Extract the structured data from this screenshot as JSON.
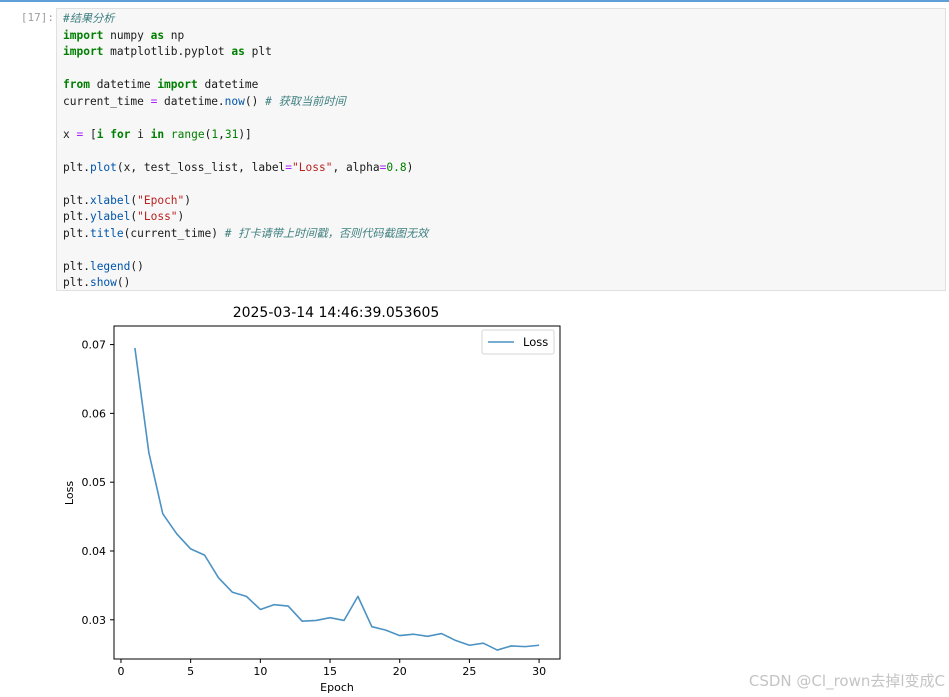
{
  "cell": {
    "prompt": "[17]:",
    "code_lines": [
      [
        {
          "t": "#结果分析",
          "c": "cm"
        }
      ],
      [
        {
          "t": "import",
          "c": "kw"
        },
        {
          "t": " numpy "
        },
        {
          "t": "as",
          "c": "kw"
        },
        {
          "t": " np"
        }
      ],
      [
        {
          "t": "import",
          "c": "kw"
        },
        {
          "t": " matplotlib.pyplot "
        },
        {
          "t": "as",
          "c": "kw"
        },
        {
          "t": " plt"
        }
      ],
      [],
      [
        {
          "t": "from",
          "c": "kw"
        },
        {
          "t": " datetime "
        },
        {
          "t": "import",
          "c": "kw"
        },
        {
          "t": " datetime"
        }
      ],
      [
        {
          "t": "current_time "
        },
        {
          "t": "=",
          "c": "op"
        },
        {
          "t": " datetime."
        },
        {
          "t": "now",
          "c": "fn"
        },
        {
          "t": "() "
        },
        {
          "t": "# 获取当前时间",
          "c": "cm"
        }
      ],
      [],
      [
        {
          "t": "x "
        },
        {
          "t": "=",
          "c": "op"
        },
        {
          "t": " ["
        },
        {
          "t": "i",
          "c": "kw"
        },
        {
          "t": " "
        },
        {
          "t": "for",
          "c": "kw"
        },
        {
          "t": " i "
        },
        {
          "t": "in",
          "c": "kw"
        },
        {
          "t": " "
        },
        {
          "t": "range",
          "c": "num"
        },
        {
          "t": "("
        },
        {
          "t": "1",
          "c": "num"
        },
        {
          "t": ","
        },
        {
          "t": "31",
          "c": "num"
        },
        {
          "t": ")]"
        }
      ],
      [],
      [
        {
          "t": "plt."
        },
        {
          "t": "plot",
          "c": "fn"
        },
        {
          "t": "(x, test_loss_list, label"
        },
        {
          "t": "=",
          "c": "op"
        },
        {
          "t": "\"Loss\"",
          "c": "str"
        },
        {
          "t": ", alpha"
        },
        {
          "t": "=",
          "c": "op"
        },
        {
          "t": "0.8",
          "c": "num"
        },
        {
          "t": ")"
        }
      ],
      [],
      [
        {
          "t": "plt."
        },
        {
          "t": "xlabel",
          "c": "fn"
        },
        {
          "t": "("
        },
        {
          "t": "\"Epoch\"",
          "c": "str"
        },
        {
          "t": ")"
        }
      ],
      [
        {
          "t": "plt."
        },
        {
          "t": "ylabel",
          "c": "fn"
        },
        {
          "t": "("
        },
        {
          "t": "\"Loss\"",
          "c": "str"
        },
        {
          "t": ")"
        }
      ],
      [
        {
          "t": "plt."
        },
        {
          "t": "title",
          "c": "fn"
        },
        {
          "t": "(current_time) "
        },
        {
          "t": "# 打卡请带上时间戳，否则代码截图无效",
          "c": "cm"
        }
      ],
      [],
      [
        {
          "t": "plt."
        },
        {
          "t": "legend",
          "c": "fn"
        },
        {
          "t": "()"
        }
      ],
      [
        {
          "t": "plt."
        },
        {
          "t": "show",
          "c": "fn"
        },
        {
          "t": "()"
        }
      ]
    ]
  },
  "chart_data": {
    "type": "line",
    "title": "2025-03-14 14:46:39.053605",
    "xlabel": "Epoch",
    "ylabel": "Loss",
    "xlim": [
      -0.5,
      31.5
    ],
    "ylim": [
      0.0243,
      0.0727
    ],
    "xticks": [
      0,
      5,
      10,
      15,
      20,
      25,
      30
    ],
    "yticks": [
      0.03,
      0.04,
      0.05,
      0.06,
      0.07
    ],
    "ytick_labels": [
      "0.03",
      "0.04",
      "0.05",
      "0.06",
      "0.07"
    ],
    "legend_position": "top-right",
    "grid": false,
    "color": "#1f77b4",
    "alpha": 0.8,
    "series": [
      {
        "name": "Loss",
        "x": [
          1,
          2,
          3,
          4,
          5,
          6,
          7,
          8,
          9,
          10,
          11,
          12,
          13,
          14,
          15,
          16,
          17,
          18,
          19,
          20,
          21,
          22,
          23,
          24,
          25,
          26,
          27,
          28,
          29,
          30
        ],
        "y": [
          0.0695,
          0.0543,
          0.0454,
          0.0425,
          0.0403,
          0.0394,
          0.0361,
          0.034,
          0.0334,
          0.0315,
          0.0322,
          0.032,
          0.0298,
          0.0299,
          0.0303,
          0.0299,
          0.0334,
          0.029,
          0.0285,
          0.0277,
          0.0279,
          0.0276,
          0.028,
          0.027,
          0.0263,
          0.0266,
          0.0256,
          0.0262,
          0.0261,
          0.0263
        ]
      }
    ]
  },
  "watermark": "CSDN @Cl_rown去掉l变成C"
}
